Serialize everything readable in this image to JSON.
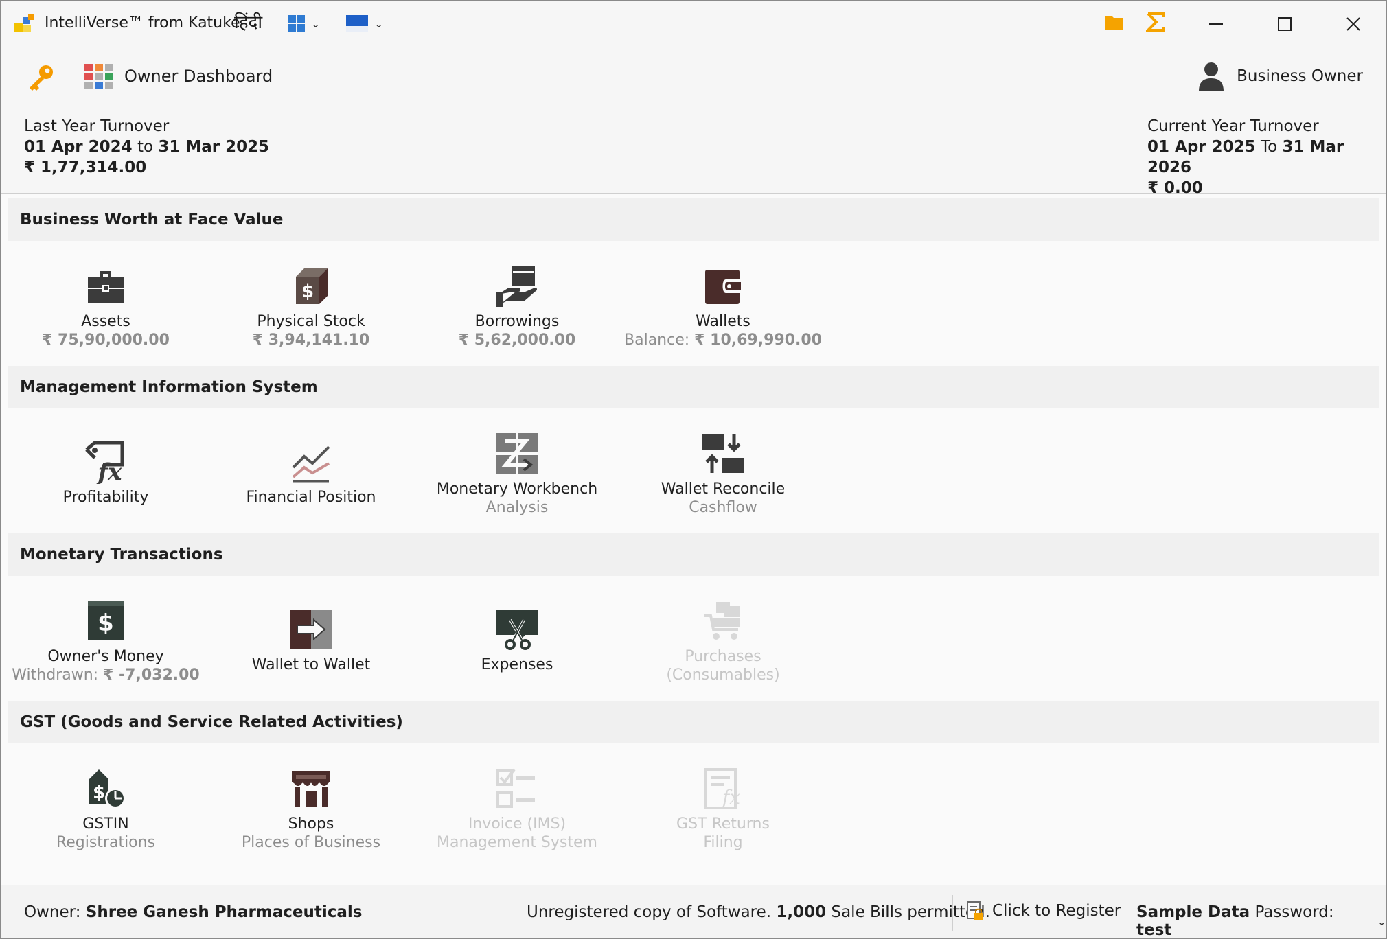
{
  "window": {
    "title": "IntelliVerse™ from Katuke",
    "language_button": "हिंदी"
  },
  "header": {
    "dashboard_label": "Owner Dashboard",
    "user_label": "Business Owner",
    "last_year": {
      "caption": "Last Year Turnover",
      "from": "01 Apr 2024",
      "connector": "to",
      "to": "31 Mar 2025",
      "amount": "₹ 1,77,314.00"
    },
    "current_year": {
      "caption": "Current Year Turnover",
      "from": "01 Apr 2025",
      "connector": "To",
      "to": "31 Mar 2026",
      "amount": "₹ 0.00"
    }
  },
  "sections": [
    {
      "title": "Business Worth at Face Value",
      "tiles": [
        {
          "label": "Assets",
          "value": "₹ 75,90,000.00",
          "icon": "briefcase-icon"
        },
        {
          "label": "Physical Stock",
          "value": "₹ 3,94,141.10",
          "icon": "stock-box-icon"
        },
        {
          "label": "Borrowings",
          "value": "₹ 5,62,000.00",
          "icon": "hand-money-icon"
        },
        {
          "label": "Wallets",
          "value_prefix": "Balance: ",
          "value": "₹ 10,69,990.00",
          "icon": "wallet-icon"
        }
      ]
    },
    {
      "title": "Management Information System",
      "tiles": [
        {
          "label": "Profitability",
          "icon": "function-tag-icon"
        },
        {
          "label": "Financial Position",
          "icon": "line-chart-icon"
        },
        {
          "label": "Monetary Workbench",
          "sub": "Analysis",
          "icon": "workbench-icon"
        },
        {
          "label": "Wallet Reconcile",
          "sub": "Cashflow",
          "icon": "reconcile-icon"
        }
      ]
    },
    {
      "title": "Monetary Transactions",
      "tiles": [
        {
          "label": "Owner's Money",
          "value_prefix": "Withdrawn: ",
          "value": "₹ -7,032.00",
          "icon": "dollar-bill-icon"
        },
        {
          "label": "Wallet to Wallet",
          "icon": "transfer-icon"
        },
        {
          "label": "Expenses",
          "icon": "scissors-icon"
        },
        {
          "label": "Purchases",
          "sub": "(Consumables)",
          "icon": "cart-icon",
          "disabled": true
        }
      ]
    },
    {
      "title": "GST (Goods and Service Related Activities)",
      "tiles": [
        {
          "label": "GSTIN",
          "sub": "Registrations",
          "icon": "tax-tag-icon"
        },
        {
          "label": "Shops",
          "sub": "Places of Business",
          "icon": "shop-icon"
        },
        {
          "label": "Invoice (IMS)",
          "sub": "Management System",
          "icon": "checklist-icon",
          "disabled": true
        },
        {
          "label": "GST Returns",
          "sub": "Filing",
          "icon": "returns-doc-icon",
          "disabled": true
        }
      ]
    }
  ],
  "status": {
    "owner_prefix": "Owner: ",
    "owner_name": "Shree Ganesh Pharmaceuticals",
    "unreg_text": "Unregistered copy of Software. ",
    "bills_count": "1,000",
    "bills_text": " Sale Bills permitted.",
    "register_label": "Click to Register",
    "sample_label": "Sample Data",
    "password_prefix": " Password: ",
    "password_value": "test"
  },
  "colors": {
    "accent_orange": "#f5a300",
    "icon_dark": "#3b3b3b",
    "icon_brown": "#4a2c2a",
    "disabled": "#c6c6c6"
  }
}
